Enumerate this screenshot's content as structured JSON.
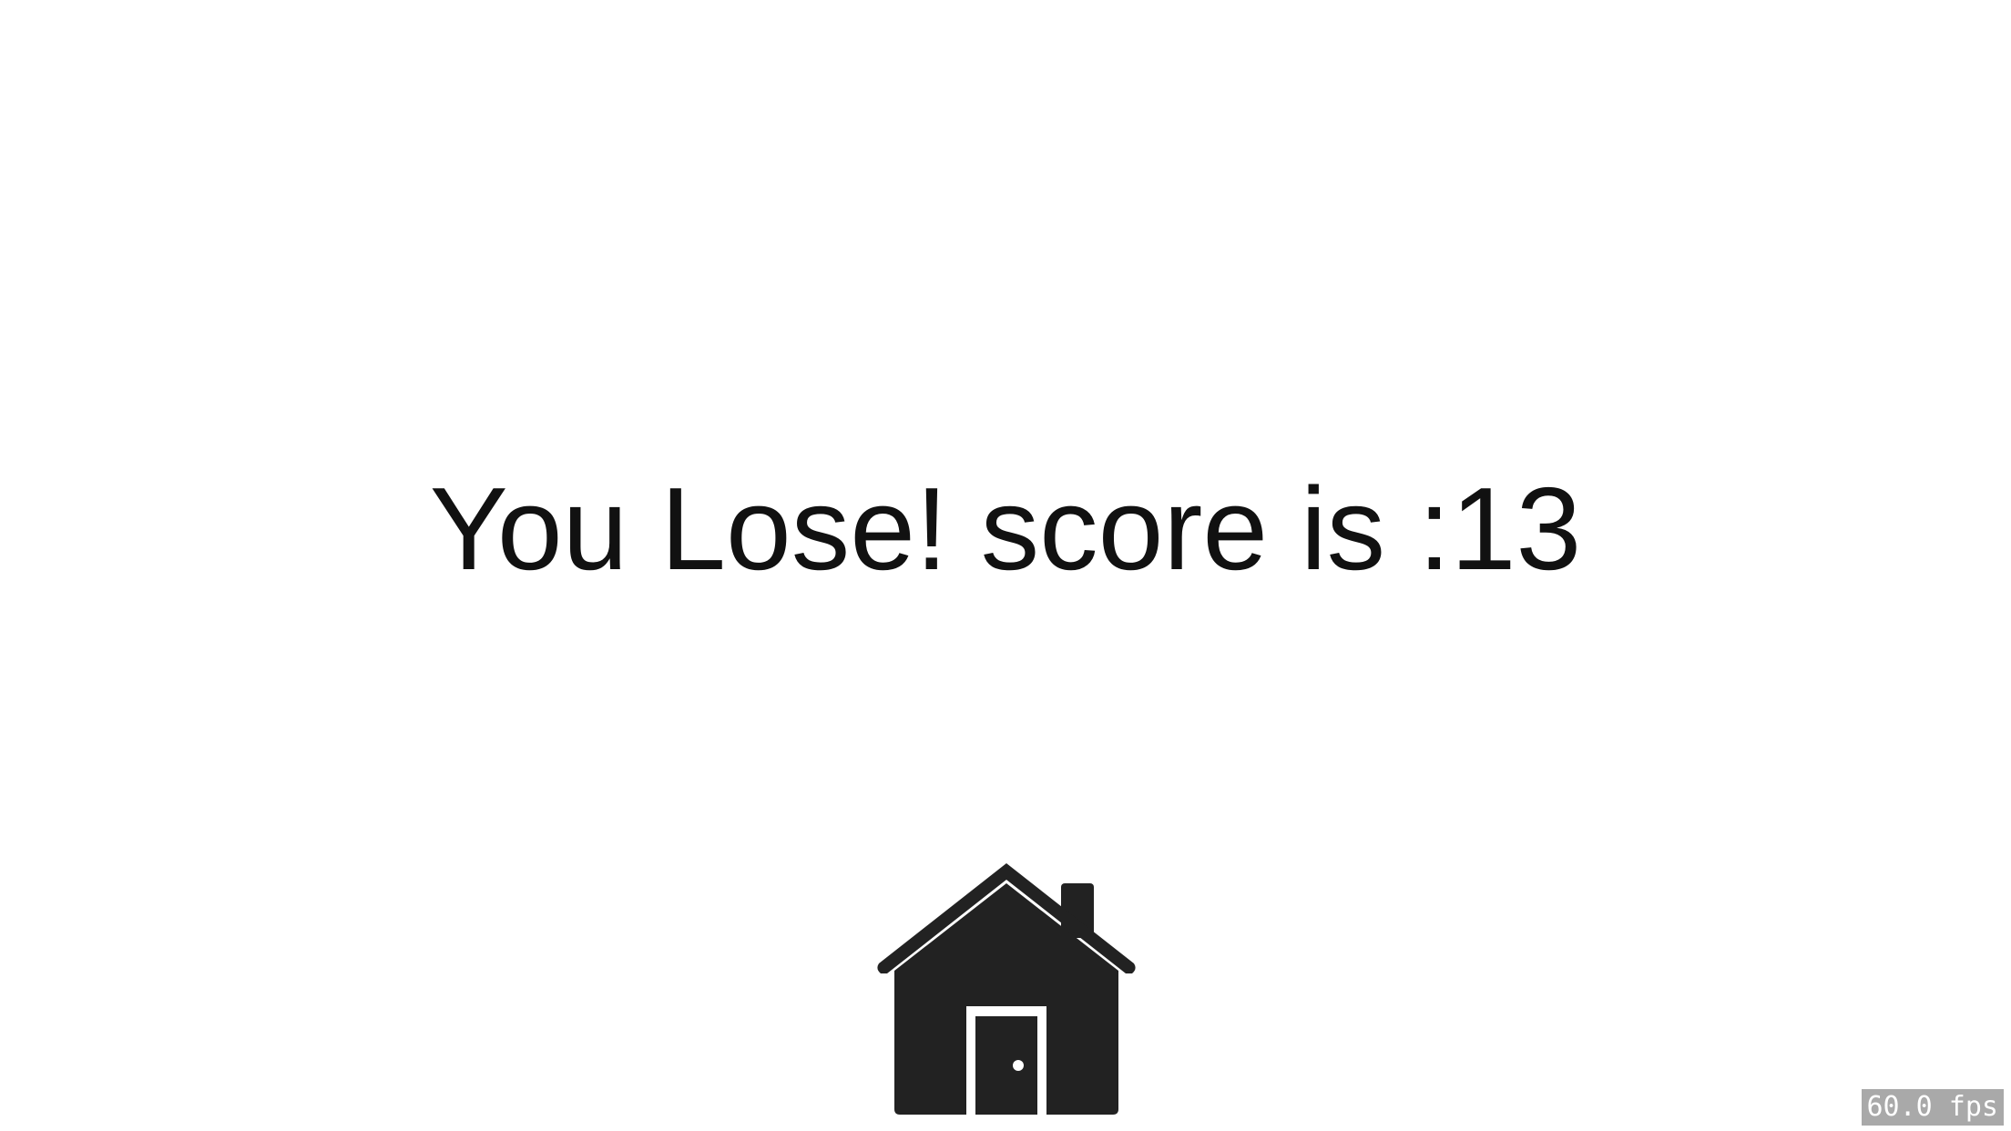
{
  "game_over": {
    "message": "You Lose! score is :13"
  },
  "home_button": {
    "icon": "home-icon",
    "color": "#222222"
  },
  "fps": {
    "label": "60.0 fps"
  }
}
